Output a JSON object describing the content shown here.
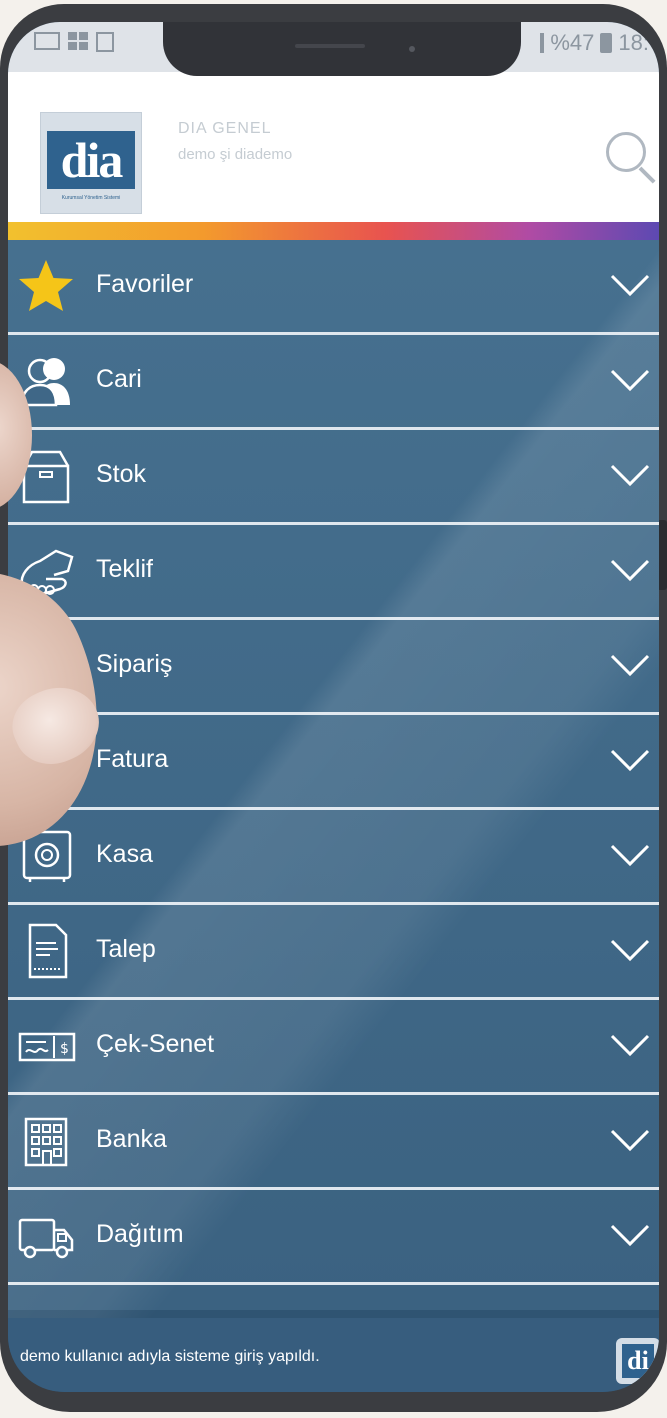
{
  "status_bar": {
    "battery": "%47",
    "time": "18:",
    "icons": [
      "laptop-icon",
      "grid-icon",
      "image-icon",
      "signal-icon",
      "battery-icon"
    ]
  },
  "header": {
    "logo_text": "dia",
    "logo_tagline": "Kurumsal Yönetim Sistemi",
    "company": "DIA GENEL",
    "user": "demo şi diademo"
  },
  "menu": {
    "items": [
      {
        "label": "Favoriler",
        "icon": "star-icon"
      },
      {
        "label": "Cari",
        "icon": "users-icon"
      },
      {
        "label": "Stok",
        "icon": "box-icon"
      },
      {
        "label": "Teklif",
        "icon": "handshake-icon"
      },
      {
        "label": "Sipariş",
        "icon": "order-list-icon"
      },
      {
        "label": "Fatura",
        "icon": "invoice-icon"
      },
      {
        "label": "Kasa",
        "icon": "safe-icon"
      },
      {
        "label": "Talep",
        "icon": "request-document-icon"
      },
      {
        "label": "Çek-Senet",
        "icon": "check-icon"
      },
      {
        "label": "Banka",
        "icon": "bank-building-icon"
      },
      {
        "label": "Dağıtım",
        "icon": "delivery-truck-icon"
      }
    ]
  },
  "toast": {
    "message": "demo kullanıcı adıyla sisteme giriş yapıldı.",
    "logo_text": "di"
  },
  "colors": {
    "menu_bg": "#3f6787",
    "accent_star": "#f5c518",
    "header_bg": "#ffffff"
  }
}
